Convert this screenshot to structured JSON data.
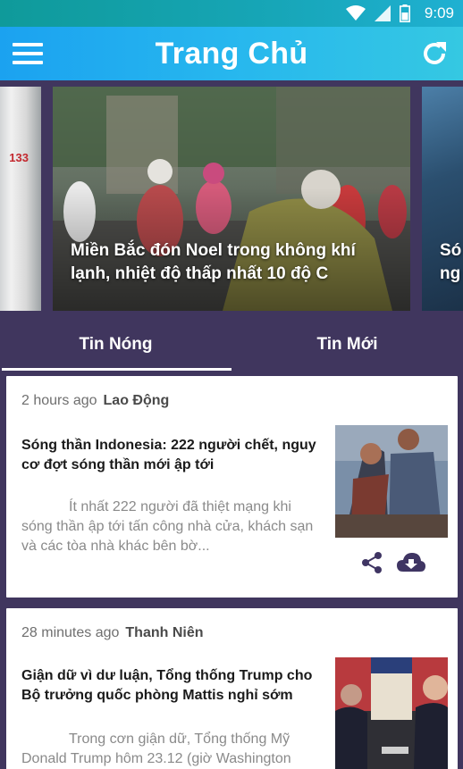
{
  "status_bar": {
    "time": "9:09",
    "icons": [
      "wifi-icon",
      "signal-icon",
      "battery-icon"
    ]
  },
  "app_bar": {
    "title": "Trang Chủ",
    "menu_icon": "hamburger-menu-icon",
    "refresh_icon": "refresh-icon",
    "gradient": [
      "#1ba2f0",
      "#35c8e2"
    ]
  },
  "carousel": {
    "current_caption": "Miền Bắc đón Noel trong không khí lạnh, nhiệt độ thấp nhất 10 độ C",
    "next_caption": "Só ng"
  },
  "tabs": [
    {
      "label": "Tin Nóng",
      "active": true
    },
    {
      "label": "Tin Mới",
      "active": false
    }
  ],
  "articles": [
    {
      "time": "2 hours ago",
      "source": "Lao Động",
      "title": "Sóng thần Indonesia: 222 người chết, nguy cơ đợt sóng thần mới ập tới",
      "description": "Ít nhất 222 người đã thiệt mạng khi sóng thần ập tới tấn công nhà cửa, khách sạn và các tòa nhà khác bên bờ...",
      "actions": [
        "share-icon",
        "cloud-download-icon"
      ]
    },
    {
      "time": "28 minutes ago",
      "source": "Thanh Niên",
      "title": "Giận dữ vì dư luận, Tổng thống Trump cho Bộ trưởng quốc phòng Mattis nghỉ sớm",
      "description": "Trong cơn giận dữ, Tổng thống Mỹ Donald Trump hôm 23.12 (giờ Washington"
    }
  ],
  "colors": {
    "background": "#40365e",
    "accent": "#3f3563",
    "card": "#ffffff"
  }
}
